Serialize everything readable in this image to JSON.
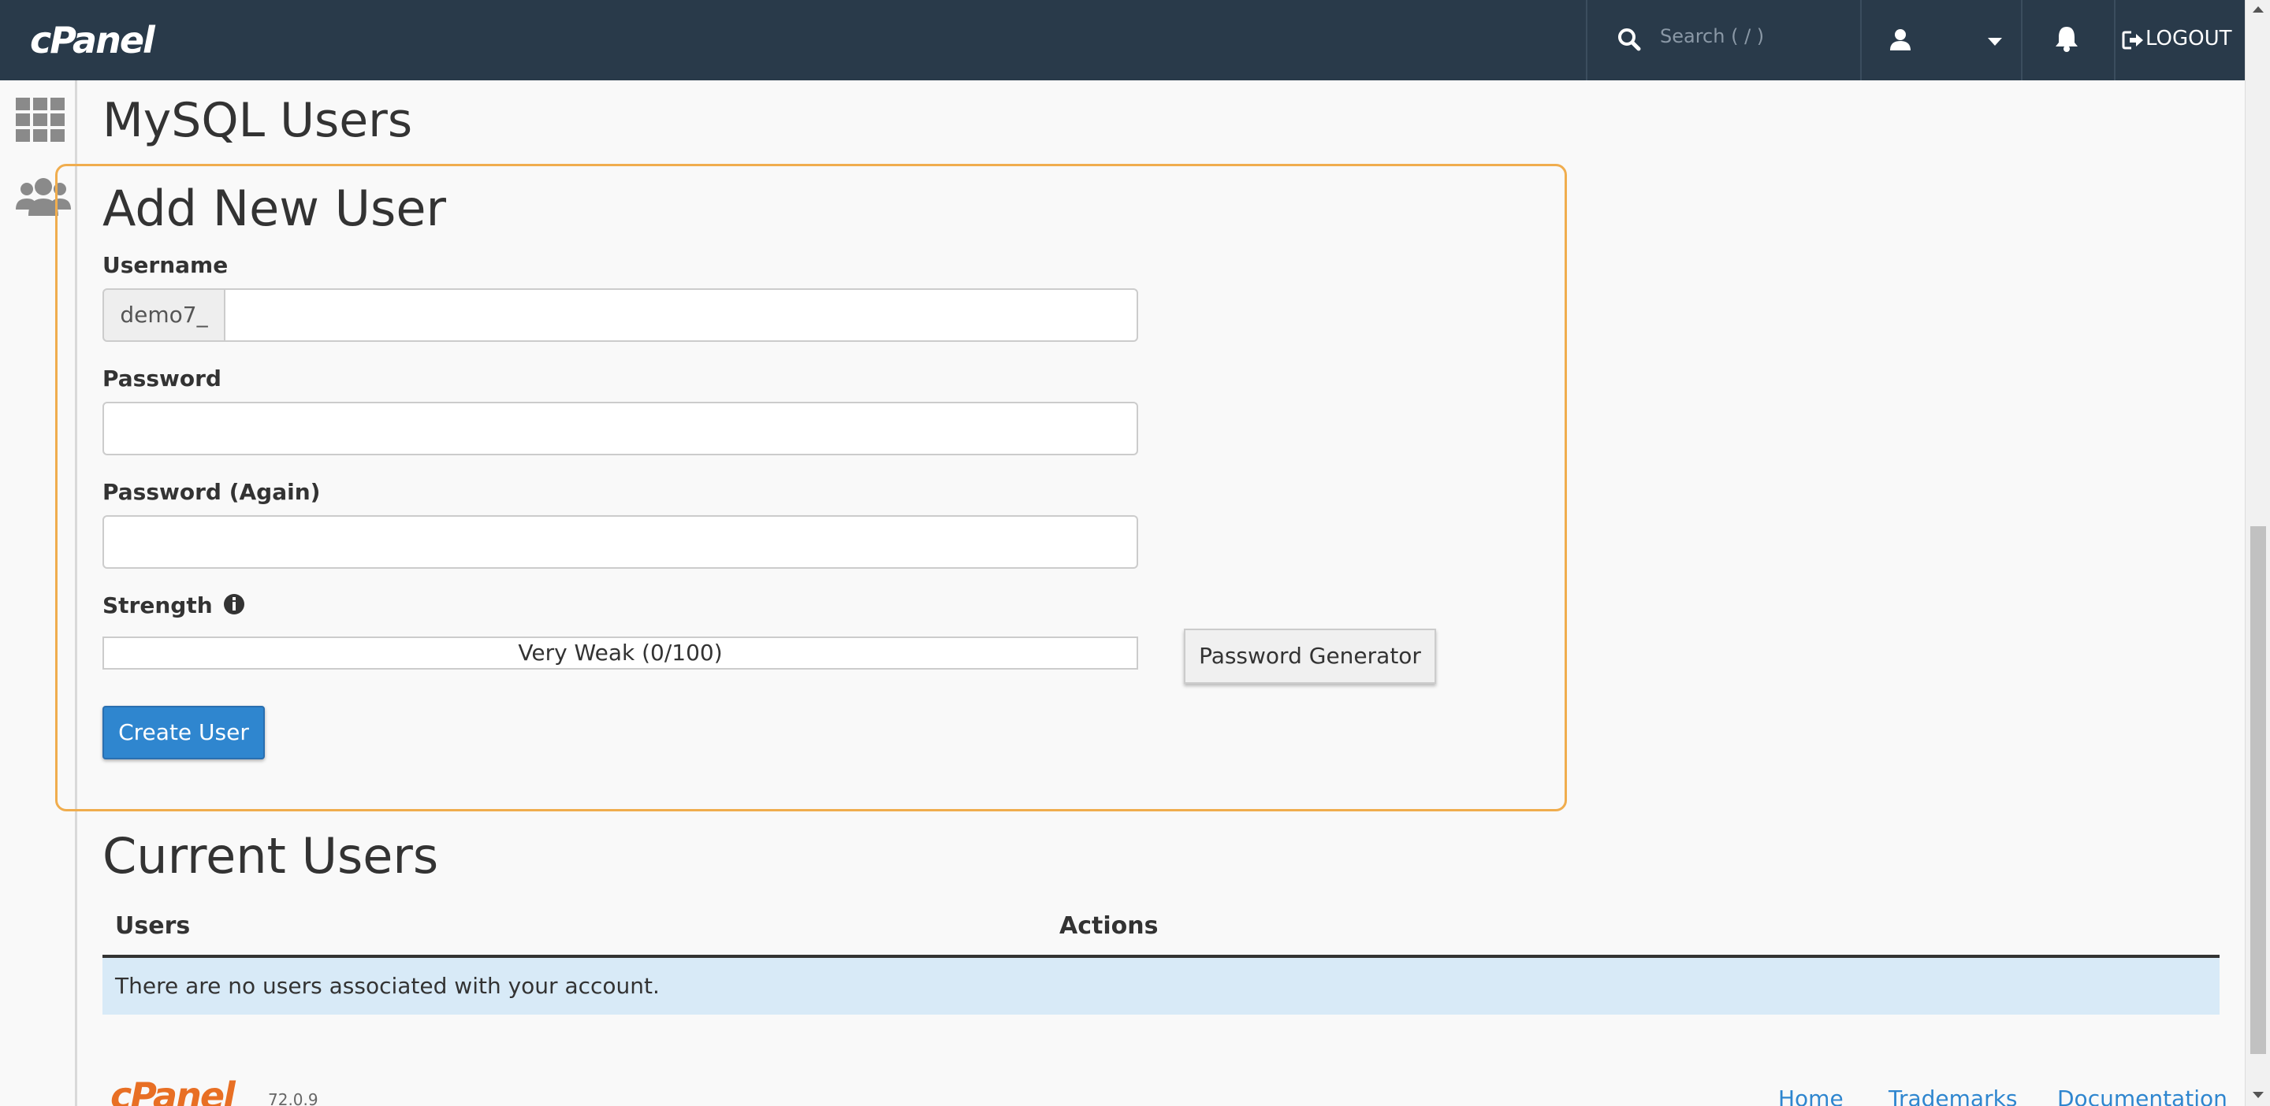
{
  "header": {
    "logo": "cPanel",
    "search_placeholder": "Search ( / )",
    "logout_label": "LOGOUT"
  },
  "page": {
    "title": "MySQL Users"
  },
  "add_user": {
    "title": "Add New User",
    "username_label": "Username",
    "username_prefix": "demo7_",
    "username_value": "",
    "password_label": "Password",
    "password_value": "",
    "password_again_label": "Password (Again)",
    "password_again_value": "",
    "strength_label": "Strength",
    "strength_text": "Very Weak (0/100)",
    "strength_score": 0,
    "password_generator_label": "Password Generator",
    "create_user_label": "Create User"
  },
  "current_users": {
    "title": "Current Users",
    "columns": [
      "Users",
      "Actions"
    ],
    "empty_message": "There are no users associated with your account."
  },
  "footer": {
    "logo": "cPanel",
    "version": "72.0.9",
    "links": [
      "Home",
      "Trademarks",
      "Documentation"
    ]
  },
  "colors": {
    "topbar": "#293a4a",
    "highlight_border": "#f0ad4e",
    "primary_button": "#2f86cf",
    "empty_row": "#d8eaf7",
    "footer_logo": "#e86f24"
  }
}
